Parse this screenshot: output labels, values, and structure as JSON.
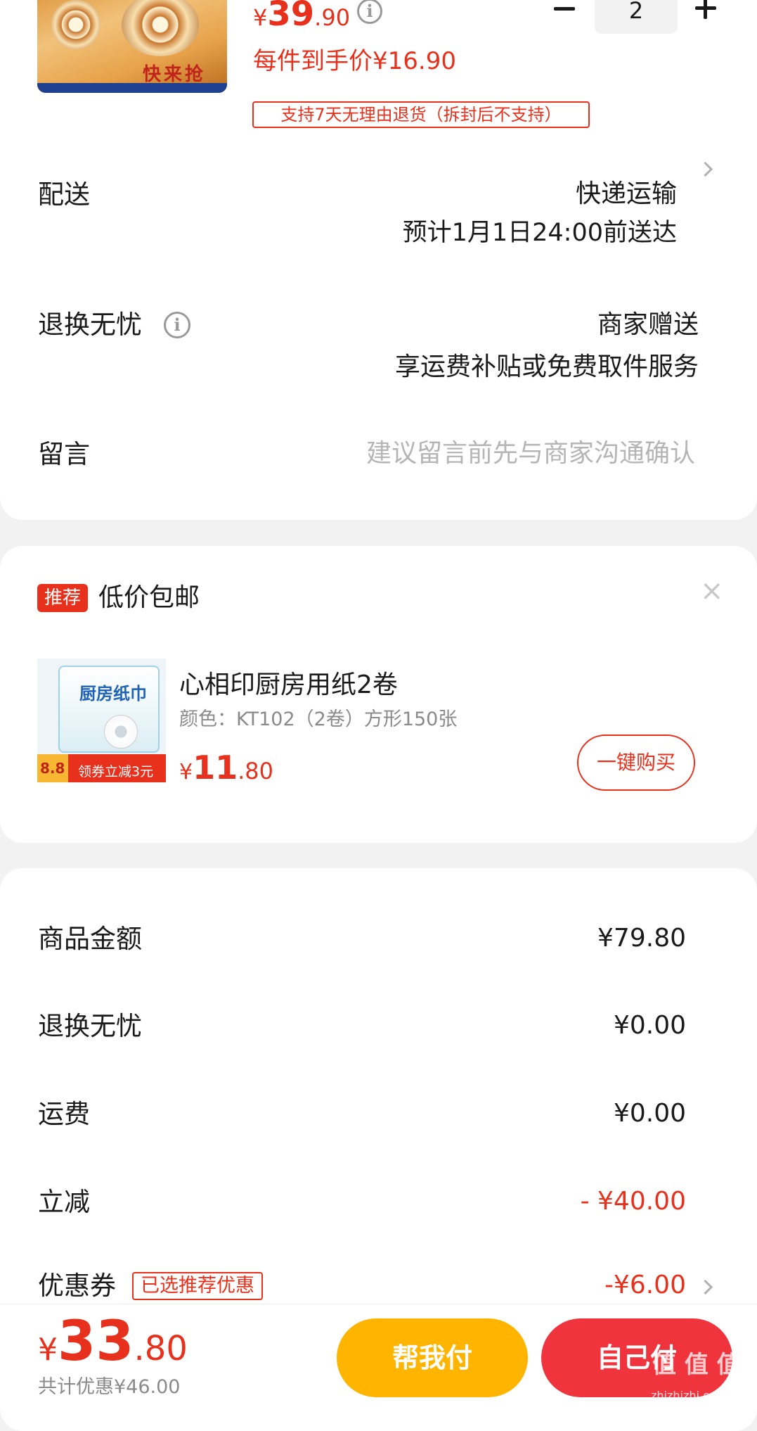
{
  "product": {
    "image_caption": "快来抢",
    "price_symbol": "¥",
    "price_int": "39",
    "price_dec": ".90",
    "qty": "2",
    "minus": "−",
    "plus": "+",
    "per_item_price": "每件到手价¥16.90",
    "return_tag": "支持7天无理由退货（拆封后不支持）"
  },
  "delivery": {
    "label": "配送",
    "method": "快递运输",
    "eta": "预计1月1日24:00前送达"
  },
  "return_worry": {
    "label": "退换无忧",
    "value_line1": "商家赠送",
    "value_line2": "享运费补贴或免费取件服务"
  },
  "message": {
    "label": "留言",
    "placeholder": "建议留言前先与商家沟通确认"
  },
  "recommend": {
    "badge": "推荐",
    "title": "低价包邮",
    "close": "×",
    "item": {
      "image_text": "厨房纸巾",
      "image_promo_badge": "8.8",
      "image_promo": "领券立减3元",
      "name": "心相印厨房用纸2卷",
      "spec": "颜色：KT102（2卷）方形150张",
      "price_symbol": "¥",
      "price_int": "11",
      "price_dec": ".80",
      "buy_button": "一键购买"
    }
  },
  "summary": {
    "rows": [
      {
        "label": "商品金额",
        "value": "¥79.80"
      },
      {
        "label": "退换无忧",
        "value": "¥0.00"
      },
      {
        "label": "运费",
        "value": "¥0.00"
      },
      {
        "label": "立减",
        "value": "- ¥40.00"
      }
    ],
    "coupon_label": "优惠券",
    "coupon_tag": "已选推荐优惠",
    "coupon_value": "-¥6.00"
  },
  "footer": {
    "total_symbol": "¥",
    "total_int": "33",
    "total_dec": ".80",
    "saved": "共计优惠¥46.00",
    "help_pay": "帮我付",
    "self_pay": "自己付",
    "watermark": "值 值 值",
    "watermark_url": "zhizhizhi.com"
  },
  "colors": {
    "accent_red": "#e8311c",
    "help_pay_bg": "#ffb400",
    "self_pay_bg": "#f0343e"
  }
}
